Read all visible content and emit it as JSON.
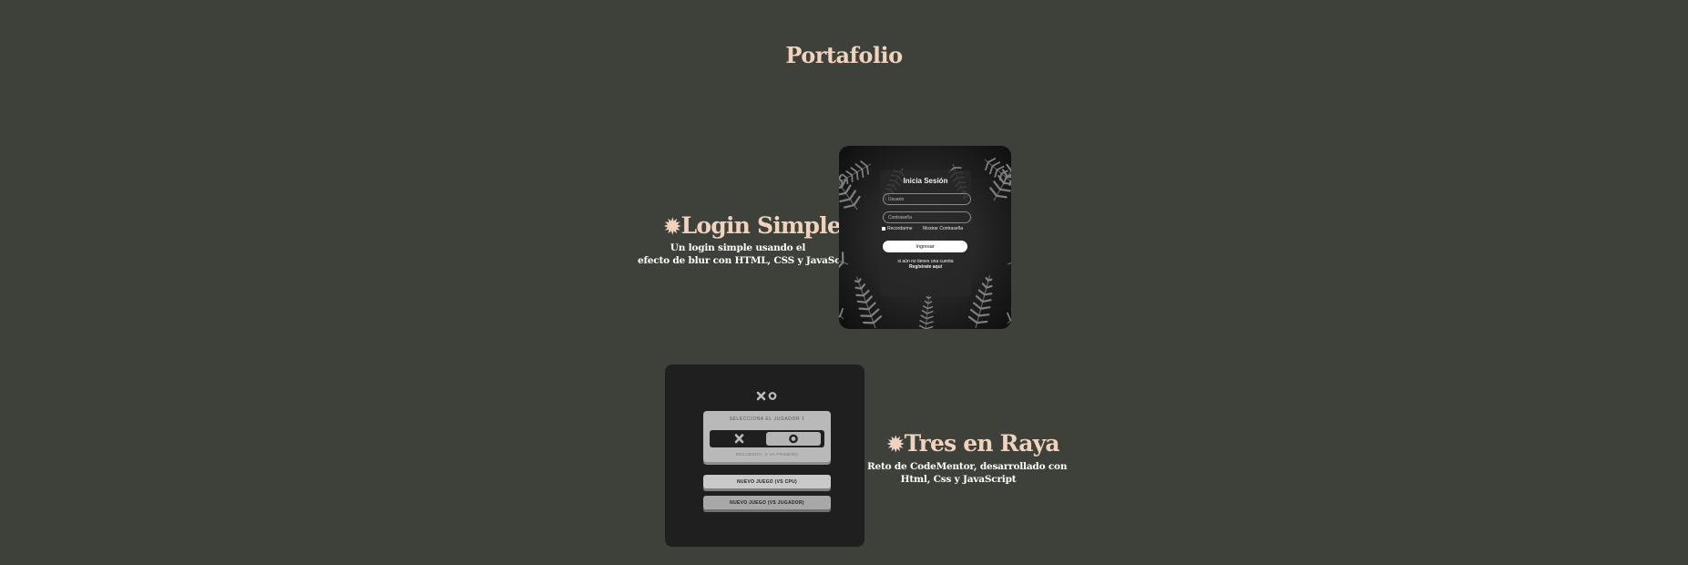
{
  "page": {
    "title": "Portafolio"
  },
  "projects": [
    {
      "star": "✹",
      "heading": "Login Simple",
      "description_lines": [
        "Un login simple usando el",
        "efecto de blur con HTML, CSS y JavaScript"
      ],
      "preview": {
        "title": "Inicia Sesión",
        "username_placeholder": "Usuario",
        "password_placeholder": "Contraseña",
        "remember_label": "Recordarme",
        "show_password_label": "Mostrar Contraseña",
        "submit_label": "Ingresar",
        "register_lines": [
          "si aún no tienes una cuenta",
          "Regístrate aquí"
        ]
      }
    },
    {
      "star": "✹",
      "heading": "Tres en Raya",
      "description_lines": [
        "Reto de CodeMentor, desarrollado con",
        "Html, Css y JavaScript"
      ],
      "preview": {
        "pick_title": "Selecciona el jugador 1",
        "pick_note": "recuerda: x va primero",
        "new_game_cpu": "Nuevo juego (vs CPU)",
        "new_game_player": "Nuevo juego (vs jugador)"
      }
    }
  ],
  "colors": {
    "background": "#3d413a",
    "heading": "#f0d2bd",
    "description": "#ffffff",
    "ttt_card": "#1f1f1f"
  }
}
